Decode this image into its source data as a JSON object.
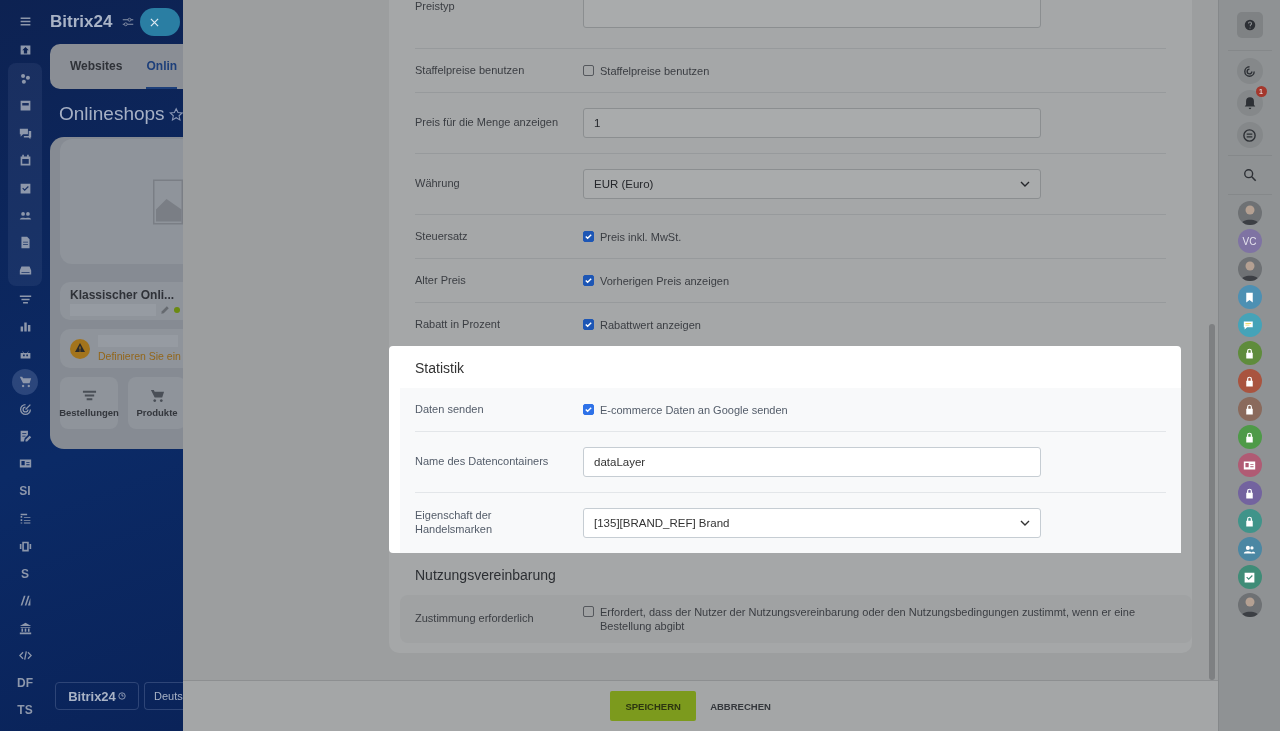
{
  "left_nav": {
    "top": [
      {
        "selected": false
      },
      {
        "selected": false
      }
    ],
    "group": [
      {
        "selected": false
      },
      {
        "selected": false
      },
      {
        "selected": false
      },
      {
        "selected": false
      },
      {
        "selected": false
      },
      {
        "selected": false
      },
      {
        "selected": false
      },
      {
        "selected": false
      }
    ],
    "rest": [
      {
        "selected": false
      },
      {
        "selected": false
      },
      {
        "selected": false
      },
      {
        "selected": true
      },
      {
        "selected": false
      },
      {
        "selected": false
      },
      {
        "selected": false
      },
      {
        "label": "SI",
        "selected": false
      },
      {
        "selected": false
      },
      {
        "selected": false
      },
      {
        "label": "S",
        "selected": false
      },
      {
        "selected": false
      },
      {
        "selected": false
      },
      {
        "selected": false
      },
      {
        "label": "DF",
        "selected": false
      },
      {
        "label": "TS",
        "selected": false
      }
    ]
  },
  "portal": {
    "logo": "Bitrix24",
    "tabs": [
      {
        "label": "Websites",
        "selected": false
      },
      {
        "label": "Onlin",
        "selected": true
      }
    ],
    "heading": "Onlineshops",
    "shop": {
      "name": "Klassischer Onli...",
      "online": true
    },
    "warning": "Definieren Sie ein",
    "shortcuts": [
      {
        "label": "Bestellungen"
      },
      {
        "label": "Produkte"
      }
    ],
    "footer_logo": "Bitrix24",
    "footer_language": "Deuts"
  },
  "form": {
    "sections": [
      {
        "highlighted": false,
        "rows": [
          {
            "kind": "textarea",
            "label": "Preistyp"
          },
          {
            "kind": "checkbox",
            "label": "Staffelpreise benutzen",
            "text": "Staffelpreise benutzen",
            "checked": false
          },
          {
            "kind": "input",
            "label": "Preis für die Menge anzeigen",
            "value": "1"
          },
          {
            "kind": "select",
            "label": "Währung",
            "value": "EUR (Euro)"
          },
          {
            "kind": "checkbox",
            "label": "Steuersatz",
            "text": "Preis inkl. MwSt.",
            "checked": true
          },
          {
            "kind": "checkbox",
            "label": "Alter Preis",
            "text": "Vorherigen Preis anzeigen",
            "checked": true
          },
          {
            "kind": "checkbox",
            "label": "Rabatt in Prozent",
            "text": "Rabattwert anzeigen",
            "checked": true
          }
        ]
      },
      {
        "title": "Statistik",
        "highlighted": true,
        "rows": [
          {
            "kind": "checkbox",
            "label": "Daten senden",
            "text": "E-commerce Daten an Google senden",
            "checked": true
          },
          {
            "kind": "input",
            "label": "Name des Datencontainers",
            "value": "dataLayer"
          },
          {
            "kind": "select",
            "label": "Eigenschaft der Handelsmarken",
            "value": "[135][BRAND_REF] Brand"
          }
        ]
      },
      {
        "title": "Nutzungsvereinbarung",
        "highlighted": false,
        "rows": [
          {
            "kind": "checkbox",
            "label": "Zustimmung erforderlich",
            "text": "Erfordert, dass der Nutzer der Nutzungsvereinbarung oder den Nutzungsbedingungen zustimmt, wenn er eine Bestellung abgibt",
            "checked": false
          }
        ]
      }
    ]
  },
  "footer": {
    "buttons": [
      {
        "label": "SPEICHERN",
        "kind": "primary"
      },
      {
        "label": "ABBRECHEN",
        "kind": "link"
      }
    ]
  },
  "right_bar": {
    "notifications_badge": "1",
    "avatars": [
      {
        "kind": "photo"
      },
      {
        "kind": "initials",
        "initials": "VC",
        "color": "#7f73a3"
      },
      {
        "kind": "photo"
      },
      {
        "kind": "bookmark",
        "color": "#4d90b3"
      },
      {
        "kind": "chat",
        "color": "#45a3b8"
      },
      {
        "kind": "lock",
        "color": "#5f8c3c"
      },
      {
        "kind": "lock",
        "color": "#a9543f"
      },
      {
        "kind": "lock",
        "color": "#8a6a5c"
      },
      {
        "kind": "lock",
        "color": "#4e9a48"
      },
      {
        "kind": "card",
        "color": "#b05b74"
      },
      {
        "kind": "lock",
        "color": "#73639f"
      },
      {
        "kind": "lock",
        "color": "#40948a"
      },
      {
        "kind": "people",
        "color": "#4b87a3"
      },
      {
        "kind": "check",
        "color": "#3f8c77"
      },
      {
        "kind": "photo"
      }
    ]
  }
}
